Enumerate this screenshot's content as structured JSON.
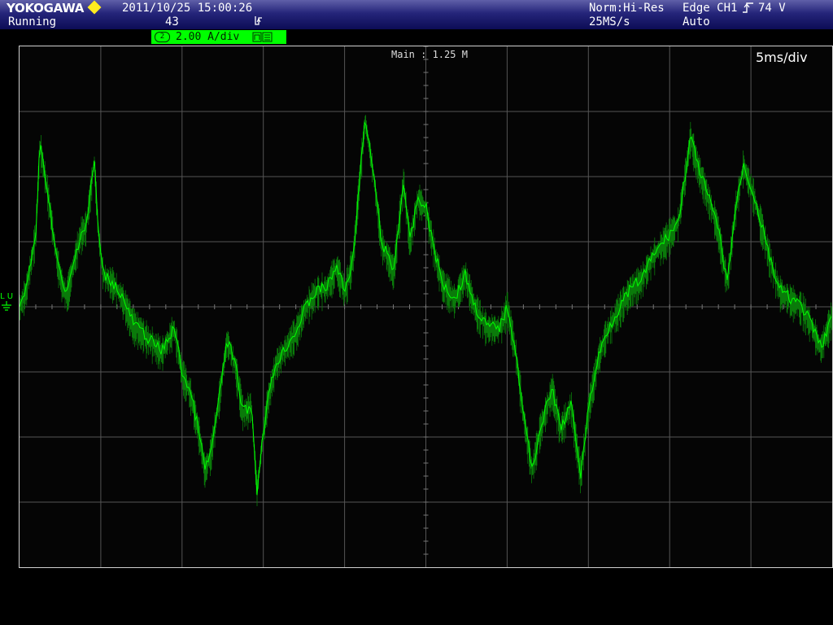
{
  "header": {
    "brand": "YOKOGAWA",
    "brand_color": "#ffeb1f",
    "datetime": "2011/10/25 15:00:26",
    "status": "Running",
    "acquisition_count": "43",
    "trigger_icon": "trigger-slope-icon",
    "acq_mode": "Norm:Hi-Res",
    "sample_rate": "25MS/s",
    "trigger_type": "Edge CH1",
    "trigger_level": "74 V",
    "trigger_mode": "Auto"
  },
  "channel": {
    "number": "2",
    "scale": "2.00 A/div",
    "color": "#00ff00",
    "ground_label": "L U"
  },
  "screen": {
    "record_length": "Main : 1.25 M",
    "timebase": "5ms/div",
    "grid_color": "#555555"
  }
}
